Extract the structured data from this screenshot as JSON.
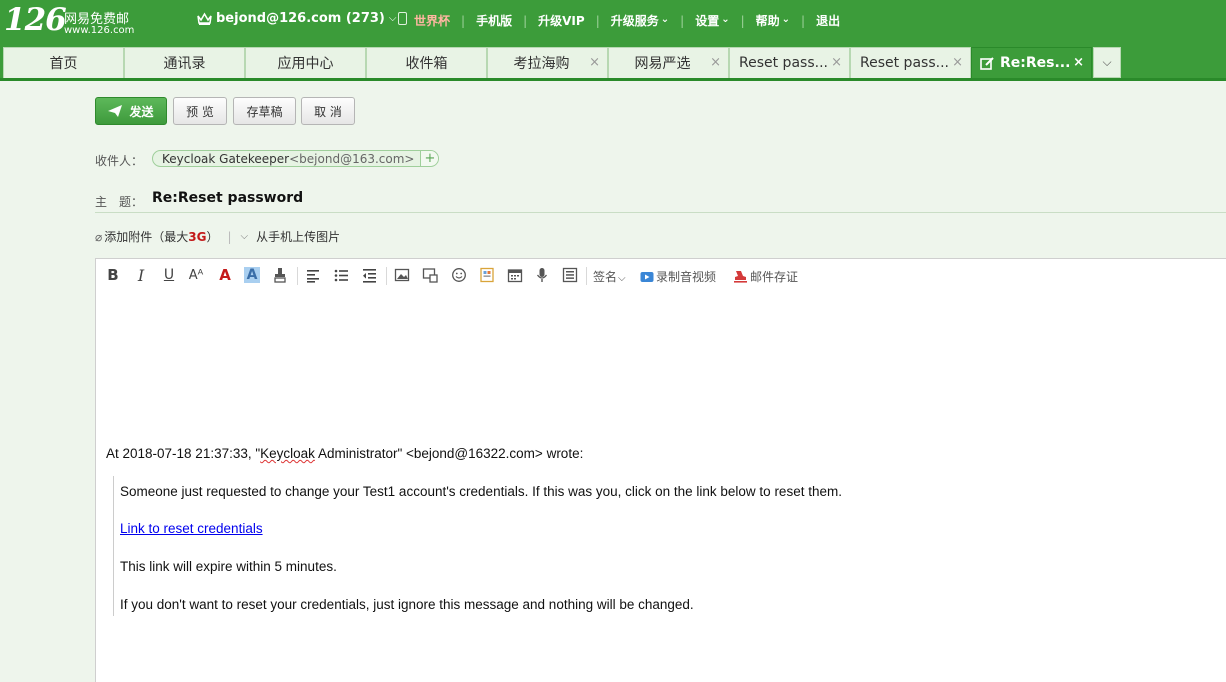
{
  "header": {
    "logo_number": "126",
    "logo_name": "网易免费邮",
    "logo_url": "www.126.com",
    "account": "bejond@126.com",
    "unread_count": "(273)",
    "nav": [
      {
        "label": "世界杯",
        "highlight": true
      },
      {
        "label": "手机版"
      },
      {
        "label": "升级VIP"
      },
      {
        "label": "升级服务",
        "dropdown": true
      },
      {
        "label": "设置",
        "dropdown": true
      },
      {
        "label": "帮助",
        "dropdown": true
      },
      {
        "label": "退出"
      }
    ]
  },
  "tabs": [
    {
      "label": "首页"
    },
    {
      "label": "通讯录"
    },
    {
      "label": "应用中心"
    },
    {
      "label": "收件箱"
    },
    {
      "label": "考拉海购",
      "close": "×"
    },
    {
      "label": "网易严选",
      "close": "×"
    },
    {
      "label": "Reset pass...",
      "close": "×"
    },
    {
      "label": "Reset pass...",
      "close": "×"
    },
    {
      "label": "Re:Res...",
      "close": "×",
      "active": true
    }
  ],
  "actions": {
    "send": "发送",
    "preview": "预 览",
    "save_draft": "存草稿",
    "cancel": "取 消"
  },
  "recipient": {
    "label": "收件人：",
    "name": "Keycloak Gatekeeper",
    "email": "<bejond@163.com>",
    "add": "+"
  },
  "subject": {
    "label": "主　题：",
    "value": "Re:Reset password"
  },
  "attachments": {
    "add_label": "添加附件（最大",
    "limit": "3G",
    "close_paren": "）",
    "upload_phone": "从手机上传图片"
  },
  "toolbar": {
    "bold": "B",
    "italic": "I",
    "underline": "U",
    "font_size": "Aᴬ",
    "font_color": "A",
    "bg_color": "A",
    "signature": "签名",
    "record_video": "录制音视频",
    "mail_evidence": "邮件存证"
  },
  "message": {
    "quote_header_pre": "At 2018-07-18 21:37:33, \"",
    "quote_header_name1": "Keycloak",
    "quote_header_post": " Administrator\" <bejond@16322.com> wrote:",
    "line1": "Someone just requested to change your Test1 account's credentials. If this was you, click on the link below to reset them.",
    "link": "Link to reset credentials",
    "line2": "This link will expire within 5 minutes.",
    "line3": "If you don't want to reset your credentials, just ignore this message and nothing will be changed."
  },
  "colors": {
    "brand_green": "#3c9c3a",
    "highlight_nav": "#ffb7a1",
    "limit_red": "#c31919",
    "link_blue": "#0000ee"
  }
}
